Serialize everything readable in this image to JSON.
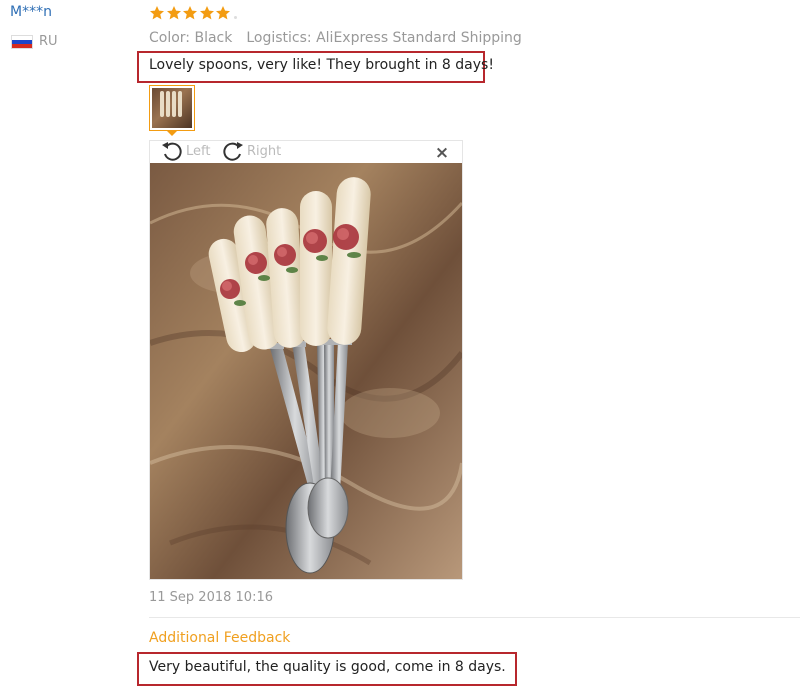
{
  "user": {
    "name": "M***n",
    "country": "RU"
  },
  "review": {
    "rating": 5,
    "rating_max": 5,
    "color_label": "Color: Black",
    "logistics_label": "Logistics: AliExpress Standard Shipping",
    "text": "Lovely spoons, very like! They brought in 8 days!",
    "date": "11 Sep 2018 10:16"
  },
  "viewer": {
    "rotate_left_label": "Left",
    "rotate_right_label": "Right",
    "close_symbol": "×"
  },
  "additional_feedback": {
    "heading": "Additional Feedback",
    "text": "Very beautiful, the quality is good, come in 8 days."
  },
  "colors": {
    "star": "#f39c12",
    "highlight_border": "#b7272d",
    "username": "#2f6fb5",
    "additional_feedback_heading": "#f0a020"
  },
  "icons": {
    "star": "star-icon",
    "flag": "russia-flag-icon",
    "rotate_left": "rotate-left-icon",
    "rotate_right": "rotate-right-icon",
    "close": "close-icon"
  }
}
